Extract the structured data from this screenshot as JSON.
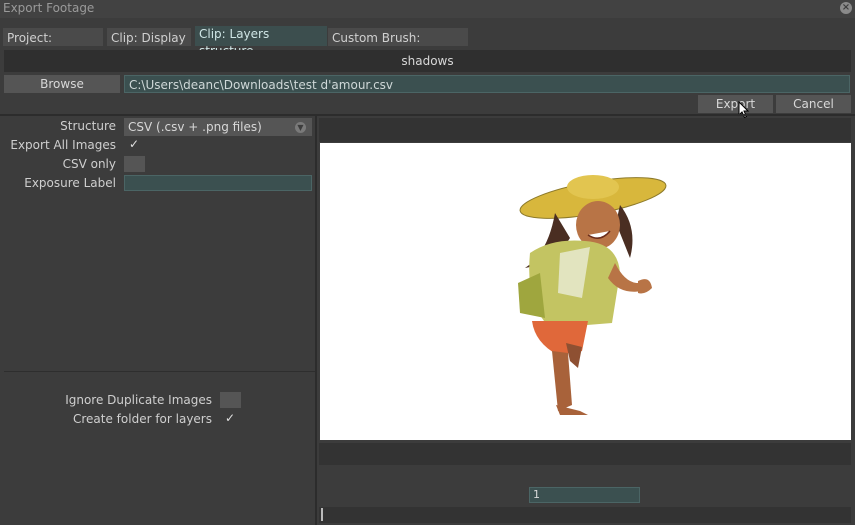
{
  "window": {
    "title": "Export Footage"
  },
  "tabs": [
    {
      "label": "Project: Display"
    },
    {
      "label": "Clip: Display"
    },
    {
      "label": "Clip: Layers structure"
    },
    {
      "label": "Custom Brush: Display"
    }
  ],
  "header": {
    "layer_name": "shadows"
  },
  "browse": {
    "button_label": "Browse",
    "path_value": "C:\\Users\\deanc\\Downloads\\test d'amour.csv"
  },
  "actions": {
    "export_label": "Export",
    "cancel_label": "Cancel"
  },
  "options": {
    "structure_label": "Structure",
    "structure_value": "CSV (.csv + .png files)",
    "export_all_images_label": "Export All Images",
    "export_all_images_checked": "✓",
    "csv_only_label": "CSV only",
    "exposure_label_label": "Exposure Label",
    "exposure_label_value": "",
    "ignore_duplicates_label": "Ignore Duplicate Images",
    "create_folder_label": "Create folder for layers",
    "create_folder_checked": "✓"
  },
  "preview": {
    "frame_value": "1"
  },
  "colors": {
    "accent": "#3b5050",
    "panel": "#3c3c3c",
    "canvas": "#ffffff"
  }
}
